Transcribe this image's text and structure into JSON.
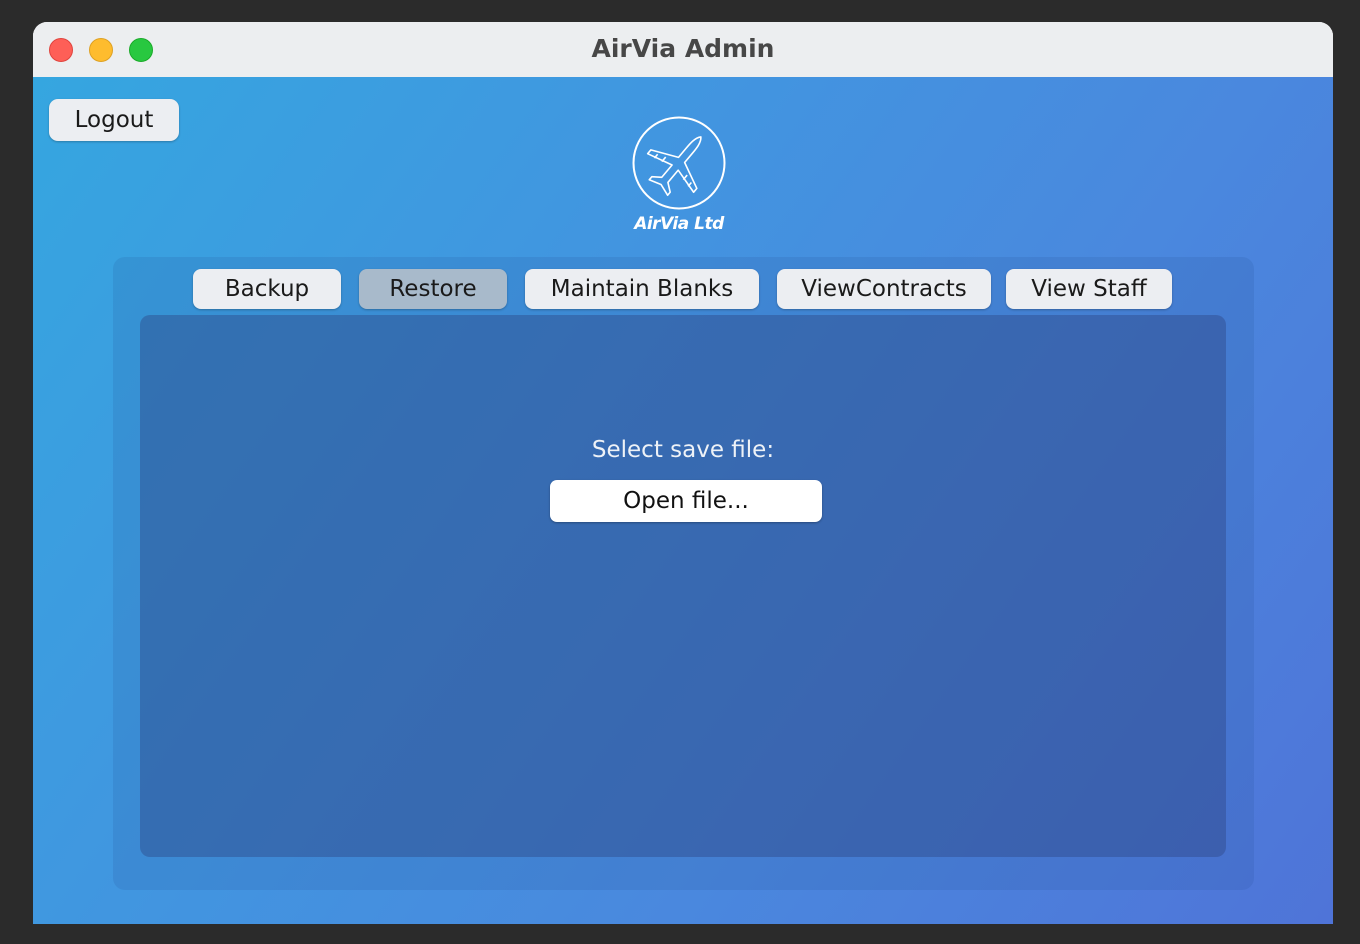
{
  "window": {
    "title": "AirVia Admin"
  },
  "header": {
    "logout_label": "Logout",
    "logo_text": "AirVia Ltd"
  },
  "tabs": [
    {
      "label": "Backup",
      "active": false
    },
    {
      "label": "Restore",
      "active": true
    },
    {
      "label": "Maintain Blanks",
      "active": false
    },
    {
      "label": "ViewContracts",
      "active": false
    },
    {
      "label": "View Staff",
      "active": false
    }
  ],
  "restore": {
    "prompt": "Select save file:",
    "open_button_label": "Open file..."
  },
  "colors": {
    "gradient_start": "#35a6e0",
    "gradient_end": "#4f74d8",
    "active_tab": "#a8bacb",
    "close": "#fe5f57",
    "minimize": "#febc2e",
    "maximize": "#28c840"
  },
  "icons": {
    "logo": "airplane-icon"
  }
}
